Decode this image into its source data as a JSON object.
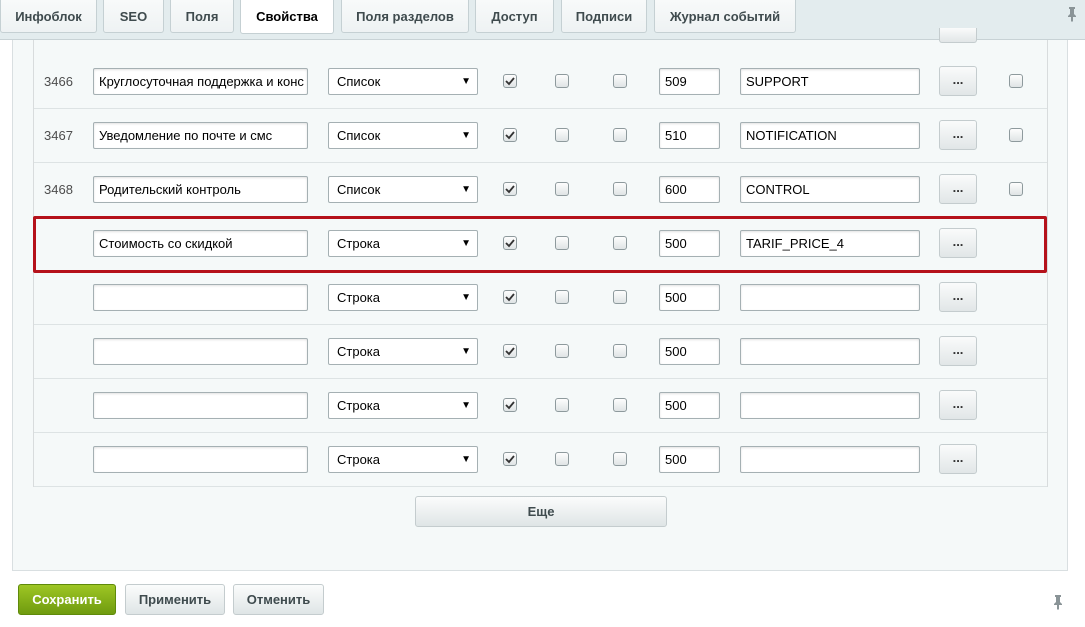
{
  "tabs": [
    "Инфоблок",
    "SEO",
    "Поля",
    "Свойства",
    "Поля разделов",
    "Доступ",
    "Подписи",
    "Журнал событий"
  ],
  "active_tab": "Свойства",
  "rows": [
    {
      "id": "3466",
      "name": "Круглосуточная поддержка и конс",
      "type": "Список",
      "c1": true,
      "c2": false,
      "c3": false,
      "sort": "509",
      "code": "SUPPORT",
      "edit": "...",
      "del": true
    },
    {
      "id": "3467",
      "name": "Уведомление по почте и смс",
      "type": "Список",
      "c1": true,
      "c2": false,
      "c3": false,
      "sort": "510",
      "code": "NOTIFICATION",
      "edit": "...",
      "del": true
    },
    {
      "id": "3468",
      "name": "Родительский контроль",
      "type": "Список",
      "c1": true,
      "c2": false,
      "c3": false,
      "sort": "600",
      "code": "CONTROL",
      "edit": "...",
      "del": true
    },
    {
      "id": "",
      "name": "Стоимость со скидкой",
      "type": "Строка",
      "c1": true,
      "c2": false,
      "c3": false,
      "sort": "500",
      "code": "TARIF_PRICE_4",
      "edit": "...",
      "del": false,
      "highlighted": true
    },
    {
      "id": "",
      "name": "",
      "type": "Строка",
      "c1": true,
      "c2": false,
      "c3": false,
      "sort": "500",
      "code": "",
      "edit": "...",
      "del": false
    },
    {
      "id": "",
      "name": "",
      "type": "Строка",
      "c1": true,
      "c2": false,
      "c3": false,
      "sort": "500",
      "code": "",
      "edit": "...",
      "del": false
    },
    {
      "id": "",
      "name": "",
      "type": "Строка",
      "c1": true,
      "c2": false,
      "c3": false,
      "sort": "500",
      "code": "",
      "edit": "...",
      "del": false
    },
    {
      "id": "",
      "name": "",
      "type": "Строка",
      "c1": true,
      "c2": false,
      "c3": false,
      "sort": "500",
      "code": "",
      "edit": "...",
      "del": false
    }
  ],
  "top_partial_row_button": "...",
  "more_button": "Еще",
  "footer": {
    "save": "Сохранить",
    "apply": "Применить",
    "cancel": "Отменить"
  },
  "colors": {
    "highlight_border": "#b5121b",
    "save_button": "#7fa817"
  }
}
